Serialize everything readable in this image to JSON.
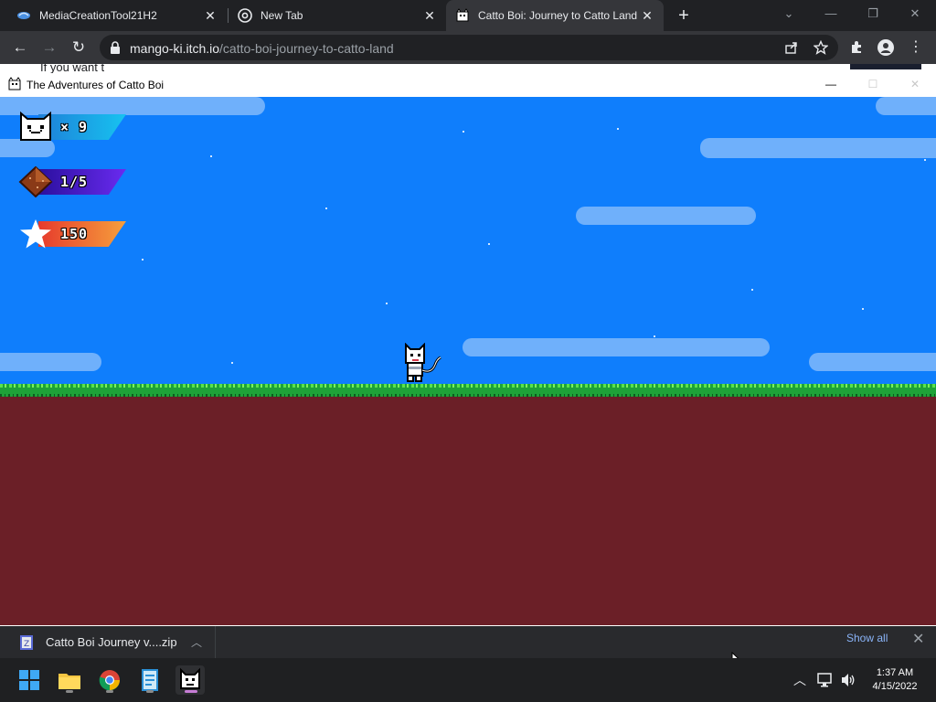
{
  "browser": {
    "tabs": [
      {
        "title": "MediaCreationTool21H2",
        "active": false
      },
      {
        "title": "New Tab",
        "active": false
      },
      {
        "title": "Catto Boi: Journey to Catto Land",
        "active": true
      }
    ],
    "url_host": "mango-ki.itch.io",
    "url_path": "/catto-boi-journey-to-catto-land",
    "page_peek_text": "If you want t"
  },
  "game_window": {
    "title": "The Adventures of Catto Boi",
    "hud": {
      "lives": "× 9",
      "gems": "1/5",
      "score": "150"
    },
    "colors": {
      "sky": "#0f7efc",
      "grass": "#1ea238",
      "dirt": "#6b1f27",
      "lives_band": "#17a8e6",
      "gems_band": "#3d1ec9",
      "score_band": "#f58a3b"
    }
  },
  "downloads": {
    "file": "Catto Boi Journey v....zip",
    "show_all": "Show all"
  },
  "taskbar": {
    "time": "1:37 AM",
    "date": "4/15/2022"
  }
}
